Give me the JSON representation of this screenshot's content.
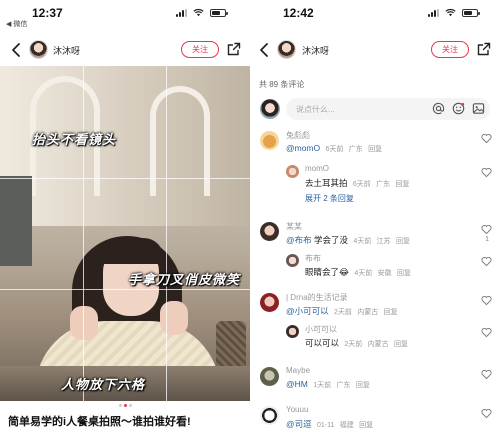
{
  "left": {
    "status": {
      "time": "12:37",
      "back_app": "◀ 微信"
    },
    "nav": {
      "username": "沐沐呀",
      "follow_label": "关注"
    },
    "photo_captions": [
      "抬头不看镜头",
      "手拿刀叉俏皮微笑",
      "人物放下六格"
    ],
    "carousel": {
      "total": 3,
      "active": 2
    },
    "post_title": "简单易学的i人餐桌拍照～谁拍谁好看!"
  },
  "right": {
    "status": {
      "time": "12:42"
    },
    "nav": {
      "username": "沐沐呀",
      "follow_label": "关注"
    },
    "comment_count": "共 89 条评论",
    "input_placeholder": "说点什么...",
    "comments": [
      {
        "name": "兔彪彪",
        "mention": "@momO",
        "text": "",
        "time": "6天前",
        "location": "广东",
        "reply": "回复",
        "likes": ""
      },
      {
        "name": "momO",
        "mention": "",
        "text": "去土耳其拍",
        "time": "6天前",
        "location": "广东",
        "reply": "回复",
        "likes": ""
      },
      {
        "name": "某某",
        "mention": "@布布",
        "text": " 学会了没",
        "time": "4天前",
        "location": "江苏",
        "reply": "回复",
        "likes": "1"
      },
      {
        "name": "布布",
        "mention": "",
        "text": "眼睛会了😂",
        "time": "4天前",
        "location": "安徽",
        "reply": "回复",
        "likes": ""
      },
      {
        "name": "| Drna的生活记录",
        "mention": "@小可可以",
        "text": "",
        "time": "2天前",
        "location": "内蒙古",
        "reply": "回复",
        "likes": ""
      },
      {
        "name": "小可可以",
        "mention": "",
        "text": "可以可以",
        "time": "2天前",
        "location": "内蒙古",
        "reply": "回复",
        "likes": ""
      },
      {
        "name": "Maybe",
        "mention": "@HM",
        "text": "",
        "time": "1天前",
        "location": "广东",
        "reply": "回复",
        "likes": ""
      },
      {
        "name": "Youuu",
        "mention": "@司逗",
        "text": "",
        "time": "01-11",
        "location": "福建",
        "reply": "回复",
        "likes": ""
      }
    ],
    "expand_label": "展开 2 条回复"
  },
  "colors": {
    "accent": "#e8364c",
    "mention": "#2c5f9e"
  },
  "icons": [
    "back-arrow-icon",
    "share-icon",
    "at-icon",
    "emoji-icon",
    "image-icon",
    "heart-icon",
    "signal-icon",
    "wifi-icon",
    "battery-icon"
  ]
}
